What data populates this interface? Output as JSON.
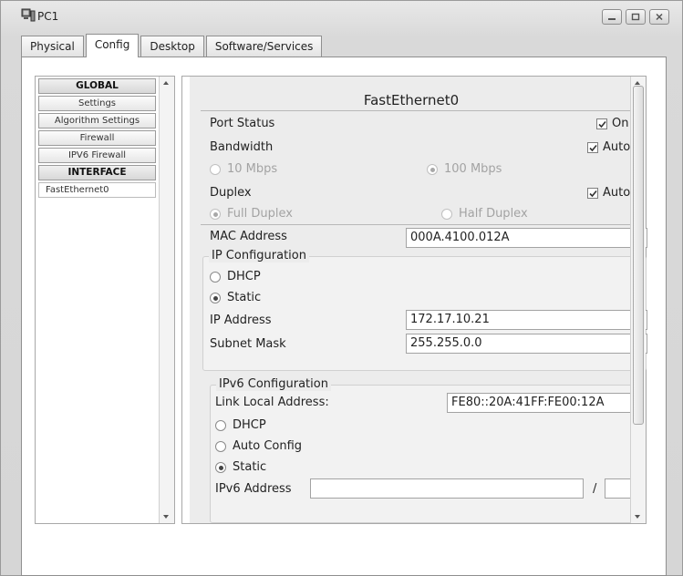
{
  "window": {
    "title": "PC1"
  },
  "tabs": [
    {
      "label": "Physical"
    },
    {
      "label": "Config"
    },
    {
      "label": "Desktop"
    },
    {
      "label": "Software/Services"
    }
  ],
  "nav": {
    "items": [
      {
        "label": "GLOBAL"
      },
      {
        "label": "Settings"
      },
      {
        "label": "Algorithm Settings"
      },
      {
        "label": "Firewall"
      },
      {
        "label": "IPV6 Firewall"
      },
      {
        "label": "INTERFACE"
      },
      {
        "label": "FastEthernet0"
      }
    ]
  },
  "interface": {
    "title": "FastEthernet0",
    "port_status": {
      "label": "Port Status",
      "check_label": "On",
      "checked": true
    },
    "bandwidth": {
      "label": "Bandwidth",
      "auto_label": "Auto",
      "auto_checked": true,
      "options": [
        "10 Mbps",
        "100 Mbps"
      ],
      "selected": "100 Mbps"
    },
    "duplex": {
      "label": "Duplex",
      "auto_label": "Auto",
      "auto_checked": true,
      "options": [
        "Full Duplex",
        "Half Duplex"
      ],
      "selected": "Full Duplex"
    },
    "mac": {
      "label": "MAC Address",
      "value": "000A.4100.012A"
    },
    "ip_config": {
      "title": "IP Configuration",
      "dhcp_label": "DHCP",
      "static_label": "Static",
      "mode": "Static",
      "ip_label": "IP Address",
      "ip_value": "172.17.10.21",
      "mask_label": "Subnet Mask",
      "mask_value": "255.255.0.0"
    },
    "ipv6_config": {
      "title": "IPv6 Configuration",
      "link_local_label": "Link Local Address:",
      "link_local_value": "FE80::20A:41FF:FE00:12A",
      "dhcp_label": "DHCP",
      "auto_label": "Auto Config",
      "static_label": "Static",
      "mode": "Static",
      "addr_label": "IPv6 Address",
      "addr_value": "",
      "slash": "/",
      "prefix_value": ""
    }
  }
}
